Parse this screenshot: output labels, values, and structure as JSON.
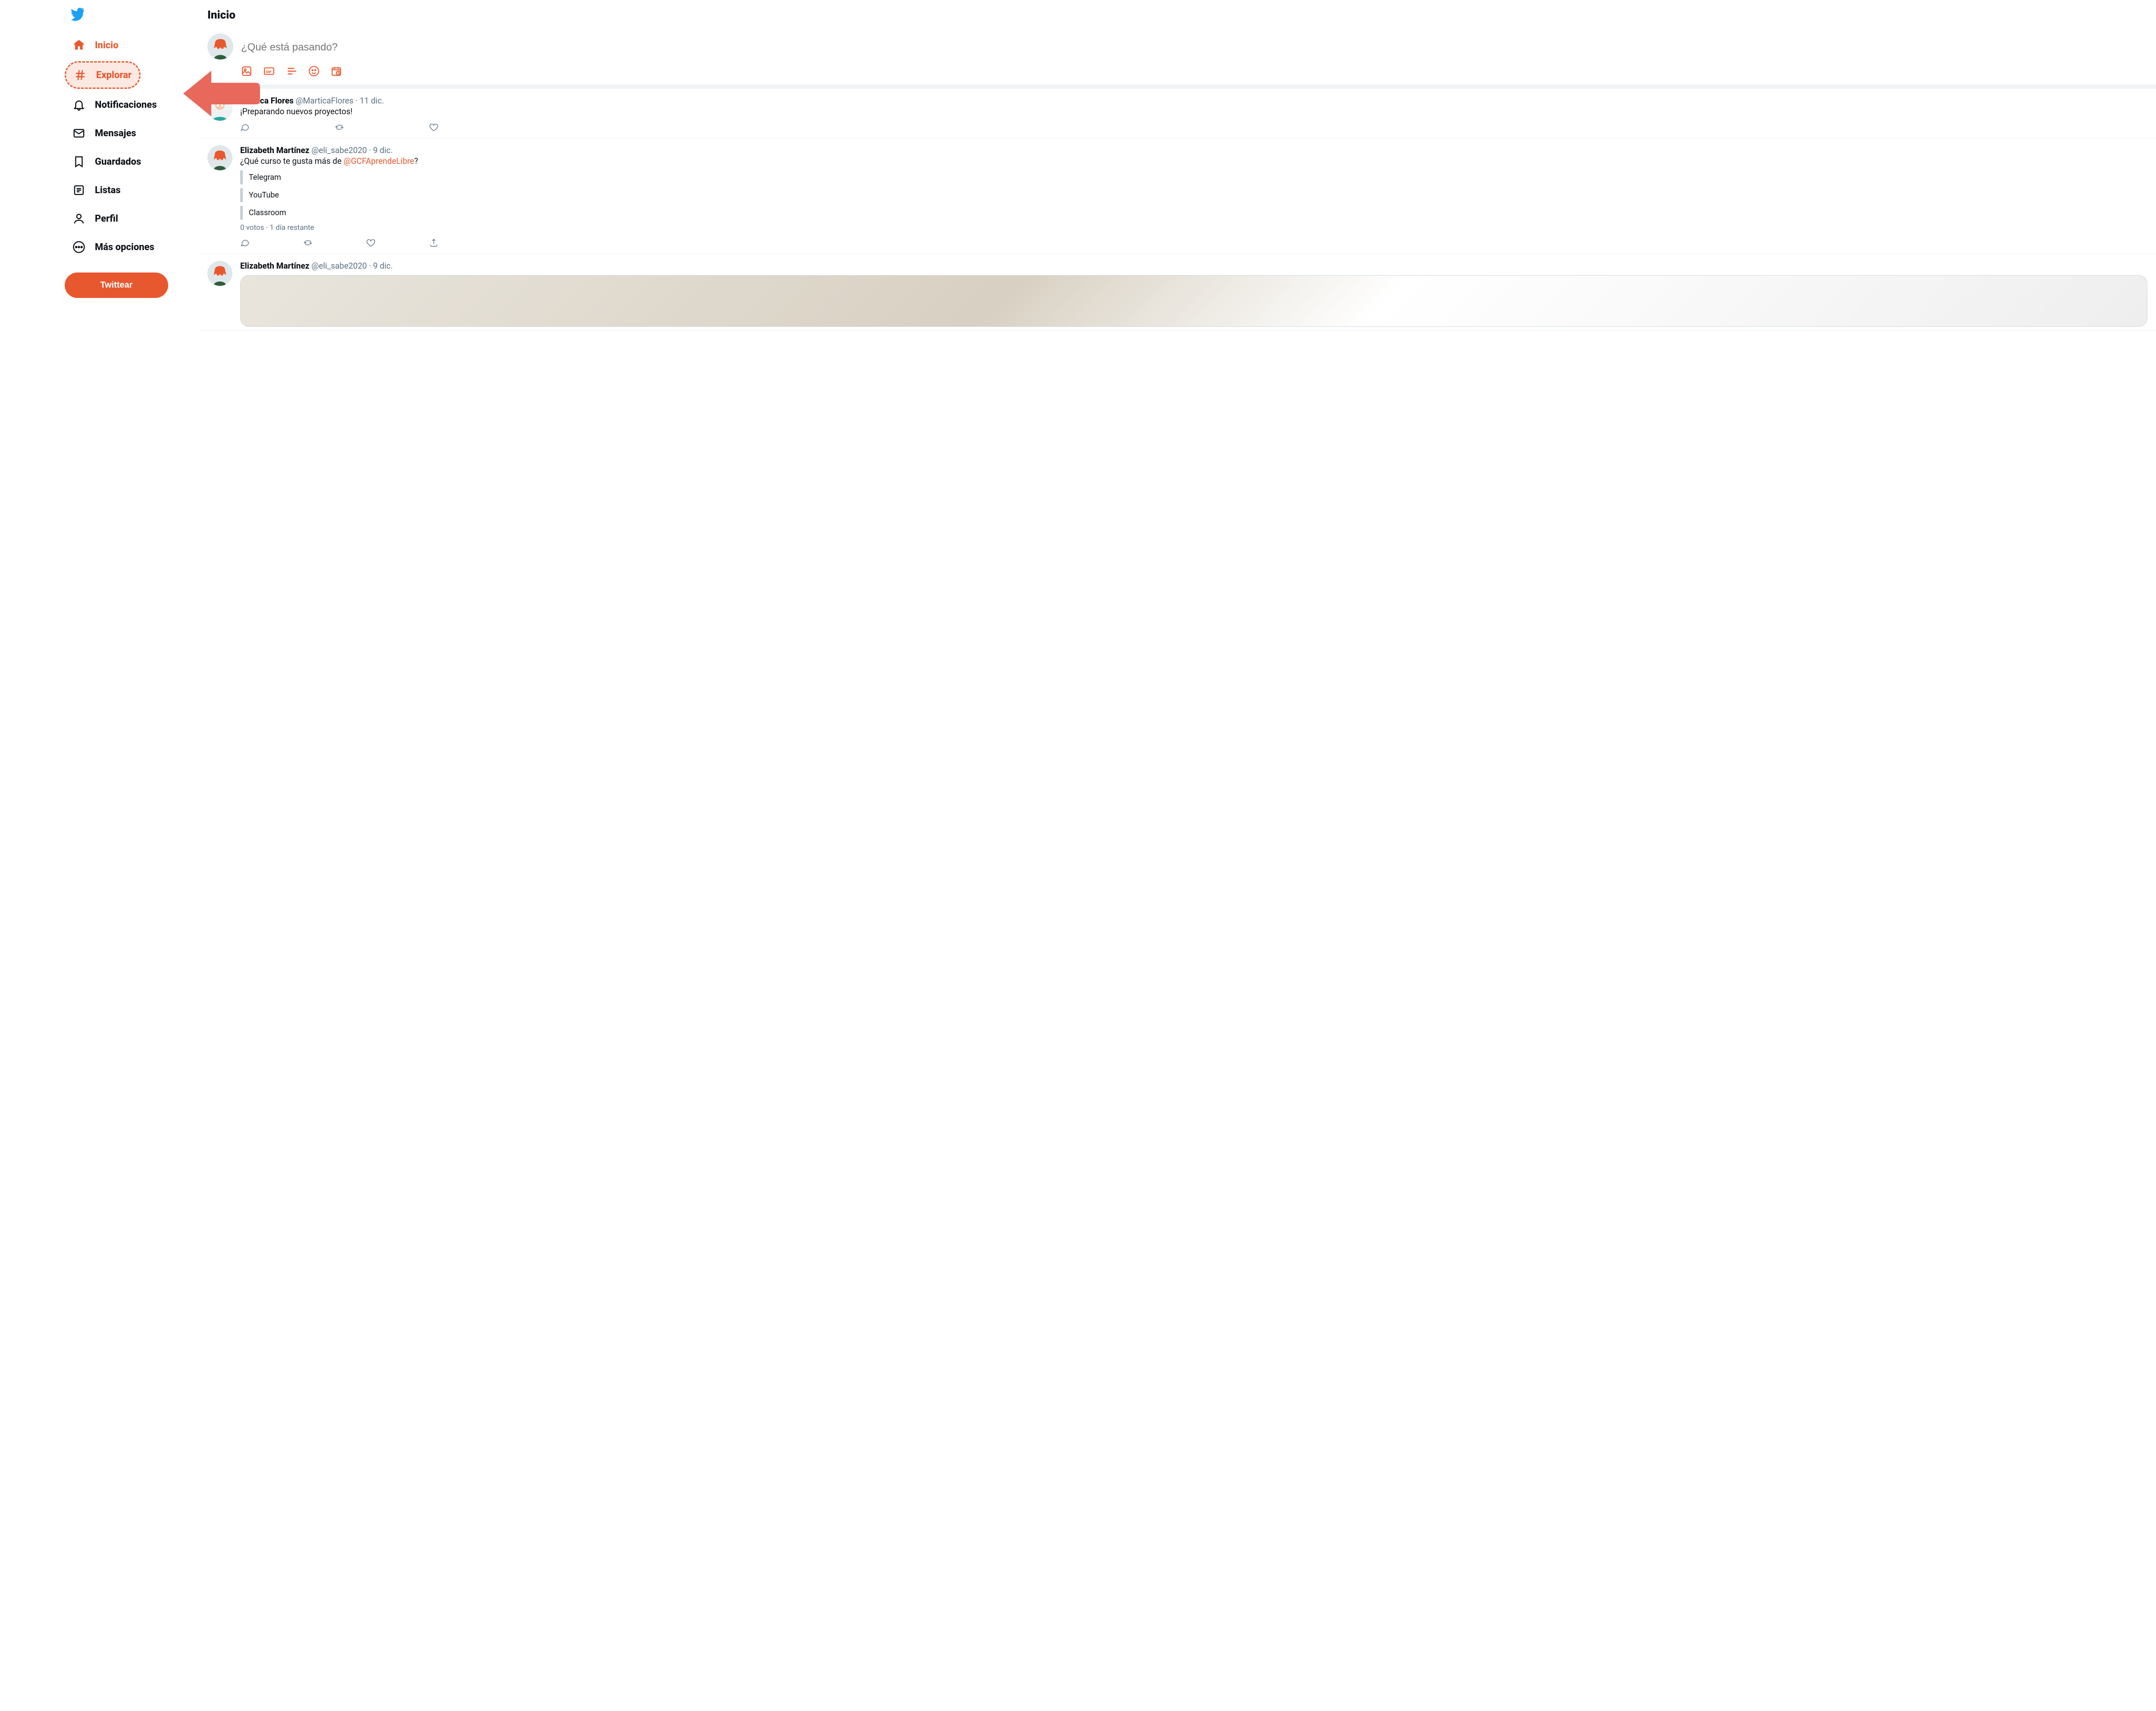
{
  "colors": {
    "accent": "#e8582e"
  },
  "sidebar": {
    "logo": "twitter-bird-icon",
    "items": [
      {
        "icon": "home-icon",
        "label": "Inicio",
        "active": true
      },
      {
        "icon": "hashtag-icon",
        "label": "Explorar",
        "highlighted": true
      },
      {
        "icon": "bell-icon",
        "label": "Notificaciones"
      },
      {
        "icon": "envelope-icon",
        "label": "Mensajes"
      },
      {
        "icon": "bookmark-icon",
        "label": "Guardados"
      },
      {
        "icon": "list-icon",
        "label": "Listas"
      },
      {
        "icon": "profile-icon",
        "label": "Perfil"
      },
      {
        "icon": "more-icon",
        "label": "Más opciones"
      }
    ],
    "tweet_button": "Twittear",
    "annotation_arrow": "arrow-left-pointing-to-explorar"
  },
  "main": {
    "header": "Inicio",
    "compose": {
      "placeholder": "¿Qué está pasando?",
      "icons": [
        "image-icon",
        "gif-icon",
        "poll-icon",
        "emoji-icon",
        "schedule-icon"
      ]
    }
  },
  "timeline": [
    {
      "name": "Martica Flores",
      "handle": "@MarticaFlores",
      "date": "11 dic.",
      "text": "¡Preparando nuevos proyectos!",
      "actions": [
        "reply",
        "retweet",
        "like"
      ]
    },
    {
      "name": "Elizabeth Martínez",
      "handle": "@eli_sabe2020",
      "date": "9 dic.",
      "text_prefix": "¿Qué curso te gusta más de ",
      "mention": "@GCFAprendeLibre",
      "text_suffix": "?",
      "poll": {
        "options": [
          "Telegram",
          "YouTube",
          "Classroom"
        ],
        "votes": "0 votos",
        "remaining": "1 día restante"
      },
      "actions": [
        "reply",
        "retweet",
        "like",
        "share"
      ]
    },
    {
      "name": "Elizabeth Martínez",
      "handle": "@eli_sabe2020",
      "date": "9 dic.",
      "has_media": true
    }
  ]
}
